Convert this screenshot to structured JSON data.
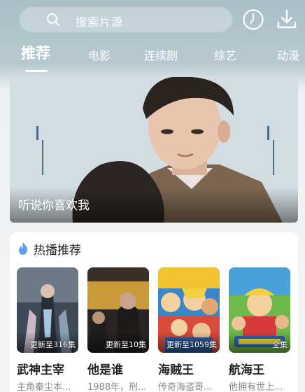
{
  "search": {
    "placeholder": "搜索片源"
  },
  "tabs": [
    {
      "label": "推荐",
      "active": true
    },
    {
      "label": "电影"
    },
    {
      "label": "连续剧"
    },
    {
      "label": "综艺"
    },
    {
      "label": "动漫"
    }
  ],
  "banner": {
    "title": "听说你喜欢我"
  },
  "hot": {
    "title": "热播推荐",
    "items": [
      {
        "title": "武神主宰",
        "badge": "更新至316集",
        "subtitle": "主角秦尘本..."
      },
      {
        "title": "他是谁",
        "badge": "更新至10集",
        "subtitle": "1988年，刑..."
      },
      {
        "title": "海贼王",
        "badge": "更新至1059集",
        "subtitle": "传奇海盗哥..."
      },
      {
        "title": "航海王",
        "badge": "全集",
        "subtitle": "他拥有世上..."
      }
    ]
  },
  "colors": {
    "accent_flame": "#5aa0f0",
    "header_bg": "#a9c0c6"
  }
}
